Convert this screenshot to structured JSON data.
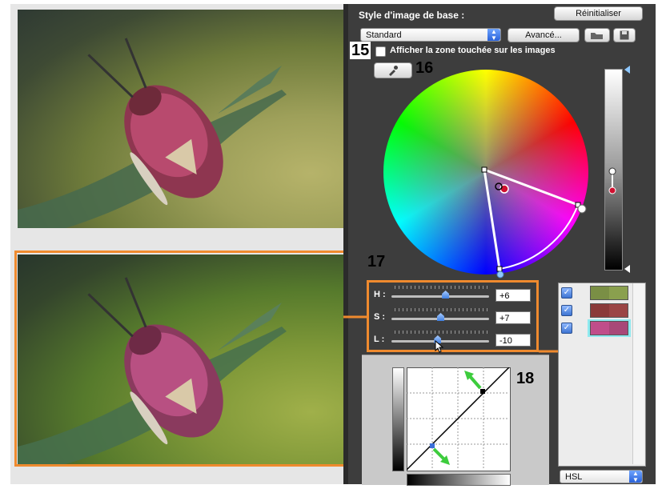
{
  "header": {
    "style_label": "Style d'image de base :",
    "reset_button": "Réinitialiser",
    "style_select": "Standard",
    "advanced_button": "Avancé...",
    "show_area_checkbox": "Afficher la zone touchée sur les images"
  },
  "callouts": {
    "c15": "15",
    "c16": "16",
    "c17": "17",
    "c18": "18"
  },
  "hsl": {
    "h_label": "H :",
    "s_label": "S :",
    "l_label": "L :",
    "h_value": "+6",
    "s_value": "+7",
    "l_value": "-10",
    "h_level": 0.55,
    "s_level": 0.5,
    "l_level": 0.47
  },
  "color_list": [
    {
      "checked": true,
      "colors": [
        "#7a8f45",
        "#8aa04e"
      ]
    },
    {
      "checked": true,
      "colors": [
        "#8a3a3a",
        "#9b4545"
      ]
    },
    {
      "checked": true,
      "colors": [
        "#c04e8a",
        "#a84878"
      ],
      "selected": true
    }
  ],
  "mode_select": "HSL",
  "colors": {
    "accent_orange": "#ef8a2e",
    "panel_bg": "#3d3d3d"
  },
  "icons": {
    "eyedropper": "eyedropper-icon",
    "save": "floppy-disk-icon",
    "load": "folder-open-icon"
  }
}
